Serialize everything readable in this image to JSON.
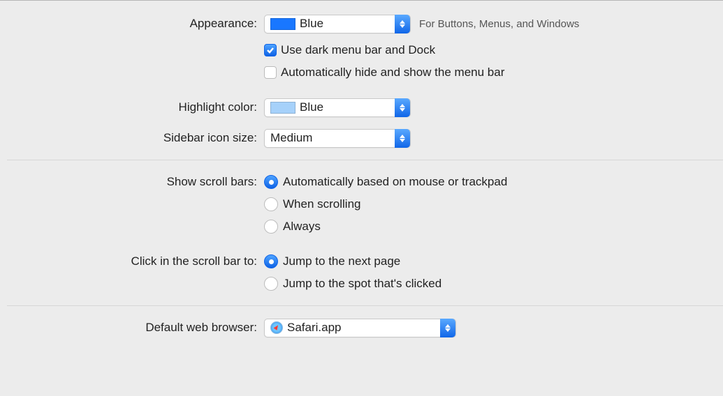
{
  "appearance": {
    "label": "Appearance:",
    "value": "Blue",
    "swatch_color": "#1977ff",
    "hint": "For Buttons, Menus, and Windows",
    "dark_menu_label": "Use dark menu bar and Dock",
    "dark_menu_checked": true,
    "auto_hide_label": "Automatically hide and show the menu bar",
    "auto_hide_checked": false
  },
  "highlight": {
    "label": "Highlight color:",
    "value": "Blue",
    "swatch_color": "#a6d1fa"
  },
  "sidebar_icon": {
    "label": "Sidebar icon size:",
    "value": "Medium"
  },
  "scroll_bars": {
    "label": "Show scroll bars:",
    "options": [
      {
        "label": "Automatically based on mouse or trackpad",
        "checked": true
      },
      {
        "label": "When scrolling",
        "checked": false
      },
      {
        "label": "Always",
        "checked": false
      }
    ]
  },
  "click_scroll": {
    "label": "Click in the scroll bar to:",
    "options": [
      {
        "label": "Jump to the next page",
        "checked": true
      },
      {
        "label": "Jump to the spot that's clicked",
        "checked": false
      }
    ]
  },
  "default_browser": {
    "label": "Default web browser:",
    "value": "Safari.app"
  }
}
